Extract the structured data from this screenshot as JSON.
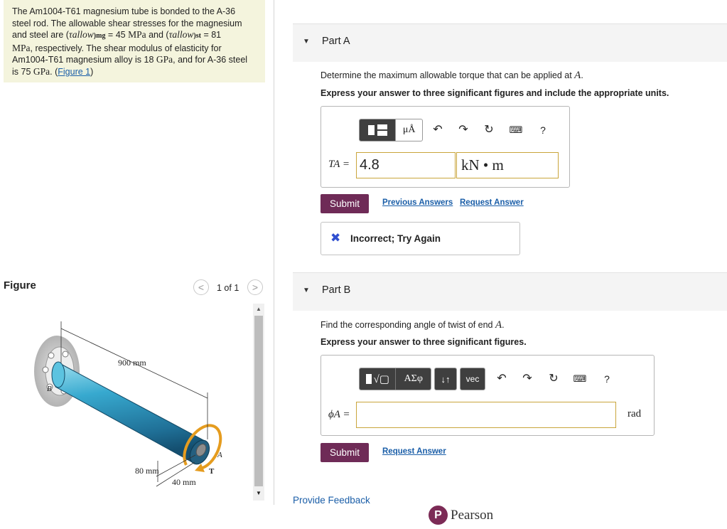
{
  "problem": {
    "line1": "The Am1004-T61 magnesium tube is bonded to the A-36",
    "line2": "steel rod. The allowable shear stresses for the magnesium",
    "line3_a": "and steel are (",
    "tau_allow_mg": "τallow",
    "mg_sub": "mg",
    "line3_b": " = 45 ",
    "mpa1": "MPa",
    "line3_c": " and (",
    "tau_allow_st": "τallow",
    "st_sub": "st",
    "line3_d": " = 81",
    "line4_unit": "MPa",
    "line4_rest": ", respectively. The shear modulus of elasticity for",
    "line5_a": "Am1004-T61 magnesium alloy is 18 ",
    "gpa1": "GPa",
    "line5_b": ", and for A-36 steel",
    "line6_a": "is 75 ",
    "gpa2": "GPa",
    "line6_b": ". (",
    "figure_link": "Figure 1",
    "line6_c": ")"
  },
  "figure": {
    "title": "Figure",
    "prev": "<",
    "next": ">",
    "counter": "1 of 1",
    "dim_length": "900 mm",
    "dim_outer": "80 mm",
    "dim_inner": "40 mm",
    "label_a": "A",
    "label_b": "B",
    "label_t": "T"
  },
  "partA": {
    "title": "Part A",
    "question_pre": "Determine the maximum allowable torque that can be applied at ",
    "question_var": "A",
    "question_post": ".",
    "instruction": "Express your answer to three significant figures and include the appropriate units.",
    "toolbar_units": "μÅ",
    "help": "?",
    "var_label": "TA =",
    "value": "4.8",
    "unit": "kN • m",
    "submit": "Submit",
    "previous_answers": "Previous Answers",
    "request_answer": "Request Answer",
    "feedback": "Incorrect; Try Again"
  },
  "partB": {
    "title": "Part B",
    "question_pre": "Find the corresponding angle of twist of end ",
    "question_var": "A",
    "question_post": ".",
    "instruction": "Express your answer to three significant figures.",
    "toolbar_greek": "ΑΣφ",
    "toolbar_arrows": "↓↑",
    "toolbar_vec": "vec",
    "help": "?",
    "var_label": "ϕA =",
    "value": "",
    "unit": "rad",
    "submit": "Submit",
    "request_answer": "Request Answer"
  },
  "footer": {
    "feedback_link": "Provide Feedback",
    "brand": "Pearson",
    "brand_mark": "P"
  },
  "colors": {
    "problem_bg": "#f4f4dd",
    "submit_bg": "#6f2b57",
    "link": "#1a5ea8",
    "error_icon": "#2f4fd0",
    "input_border": "#c9a53b"
  }
}
